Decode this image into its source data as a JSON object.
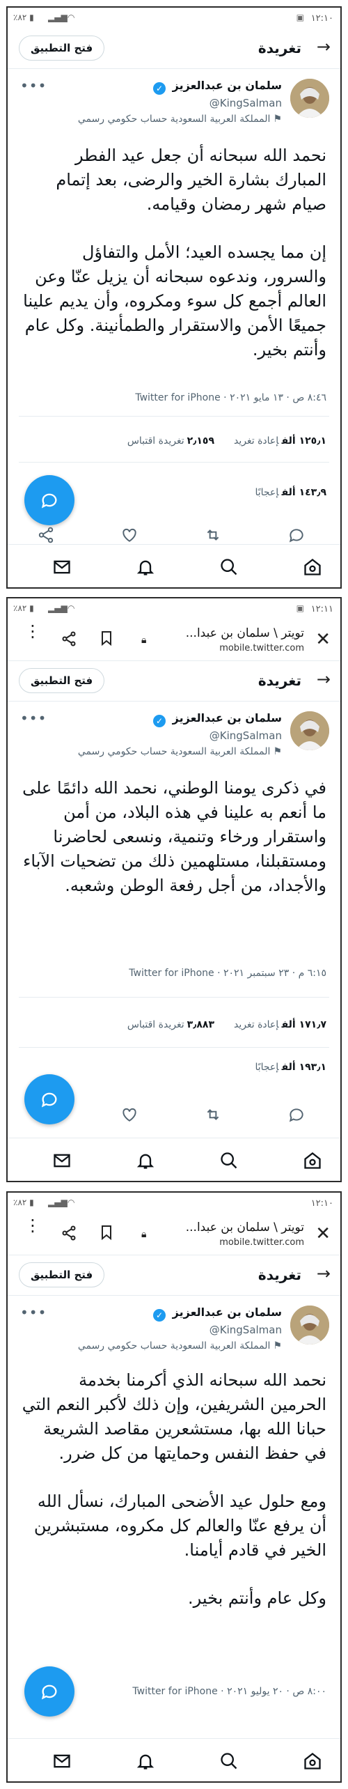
{
  "colors": {
    "accent": "#1d9bf0",
    "text": "#0f1419",
    "muted": "#536471",
    "border": "#e6ecf0"
  },
  "icons": [
    "battery-icon",
    "signal-icon",
    "wifi-icon",
    "image-icon",
    "close-icon",
    "lock-icon",
    "bookmark-icon",
    "share-icon",
    "more-vertical-icon",
    "arrow-right-icon",
    "verified-badge-icon",
    "flag-icon",
    "more-horizontal-icon",
    "reply-icon",
    "retweet-icon",
    "like-icon",
    "share-icon",
    "compose-icon",
    "mail-icon",
    "bell-icon",
    "search-icon",
    "home-icon"
  ],
  "panels": [
    {
      "status": {
        "time": "١٢:١٠",
        "battery": "٪٨٢"
      },
      "header": {
        "title": "تغريدة",
        "open_app": "فتح التطبيق"
      },
      "author": {
        "name": "سلمان بن عبدالعزيز",
        "handle": "@KingSalman",
        "label": "المملكة العربية السعودية حساب حكومي رسمي"
      },
      "paragraphs": [
        "نحمد الله سبحانه أن جعل عيد الفطر المبارك بشارة الخير والرضى، بعد إتمام صيام شهر رمضان وقيامه.",
        "إن مما يجسده العيد؛ الأمل والتفاؤل والسرور، وندعوه سبحانه أن يزيل عنّا وعن العالم أجمع كل سوء ومكروه، وأن يديم علينا جميعًا الأمن والاستقرار والطمأنينة. وكل عام وأنتم بخير."
      ],
      "meta": "٨:٤٦ ص · ١٣ مايو ٢٠٢١ · Twitter for iPhone",
      "retweets_value": "١٢٥٫١ ألف",
      "retweets_label": "إعادة تغريد",
      "quotes_value": "٢٫١٥٩",
      "quotes_label": "تغريدة اقتباس",
      "likes_value": "١٤٣٫٩ ألف",
      "likes_label": "إعجابًا"
    },
    {
      "status": {
        "time": "١٢:١١",
        "battery": "٪٨٢"
      },
      "browser": {
        "title": "تويتر \\ سلمان بن عبدا...",
        "url": "mobile.twitter.com"
      },
      "header": {
        "title": "تغريدة",
        "open_app": "فتح التطبيق"
      },
      "author": {
        "name": "سلمان بن عبدالعزيز",
        "handle": "@KingSalman",
        "label": "المملكة العربية السعودية حساب حكومي رسمي"
      },
      "paragraphs": [
        "في ذكرى يومنا الوطني، نحمد الله دائمًا على ما أنعم به علينا في هذه البلاد، من أمن واستقرار ورخاء وتنمية، ونسعى لحاضرنا ومستقبلنا، مستلهمين ذلك من تضحيات الآباء والأجداد، من أجل رفعة الوطن وشعبه."
      ],
      "meta": "٦:١٥ م · ٢٣ سبتمبر ٢٠٢١ · Twitter for iPhone",
      "retweets_value": "١٧١٫٧ ألف",
      "retweets_label": "إعادة تغريد",
      "quotes_value": "٣٫٨٨٣",
      "quotes_label": "تغريدة اقتباس",
      "likes_value": "١٩٣٫١ ألف",
      "likes_label": "إعجابًا"
    },
    {
      "status": {
        "time": "١٢:١٠",
        "battery": "٪٨٢"
      },
      "browser": {
        "title": "تويتر \\ سلمان بن عبدا...",
        "url": "mobile.twitter.com"
      },
      "header": {
        "title": "تغريدة",
        "open_app": "فتح التطبيق"
      },
      "author": {
        "name": "سلمان بن عبدالعزيز",
        "handle": "@KingSalman",
        "label": "المملكة العربية السعودية حساب حكومي رسمي"
      },
      "paragraphs": [
        "نحمد الله سبحانه الذي أكرمنا بخدمة الحرمين الشريفين، وإن ذلك لأكبر النعم التي حبانا الله بها، مستشعرين مقاصد الشريعة في حفظ النفس وحمايتها من كل ضرر.",
        "ومع حلول عيد الأضحى المبارك، نسأل الله أن يرفع عنّا والعالم كل مكروه، مستبشرين الخير في قادم أيامنا.",
        "وكل عام وأنتم بخير."
      ],
      "meta": "٨:٠٠ ص · ٢٠ يوليو ٢٠٢١ · Twitter for iPhone"
    }
  ]
}
